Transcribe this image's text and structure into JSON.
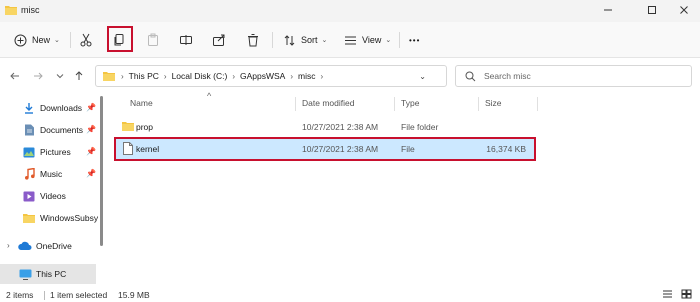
{
  "window": {
    "title": "misc",
    "minimize_icon": "minimize-icon",
    "maximize_icon": "maximize-icon",
    "close_icon": "close-icon"
  },
  "toolbar": {
    "new_label": "New",
    "sort_label": "Sort",
    "view_label": "View",
    "more_label": "•••",
    "icons": [
      "new-icon",
      "cut-icon",
      "copy-icon",
      "paste-icon",
      "rename-icon",
      "share-icon",
      "delete-icon",
      "sort-icon",
      "view-icon"
    ]
  },
  "address": {
    "breadcrumbs": [
      "This PC",
      "Local Disk (C:)",
      "GAppsWSA",
      "misc"
    ],
    "search_placeholder": "Search misc"
  },
  "sidebar": {
    "items": [
      {
        "label": "Downloads",
        "icon": "downloads-icon",
        "pinned": true
      },
      {
        "label": "Documents",
        "icon": "documents-icon",
        "pinned": true
      },
      {
        "label": "Pictures",
        "icon": "pictures-icon",
        "pinned": true
      },
      {
        "label": "Music",
        "icon": "music-icon",
        "pinned": true
      },
      {
        "label": "Videos",
        "icon": "videos-icon",
        "pinned": false
      },
      {
        "label": "WindowsSubsy",
        "icon": "folder-icon",
        "pinned": false
      },
      {
        "label": "OneDrive",
        "icon": "onedrive-icon",
        "pinned": false
      },
      {
        "label": "This PC",
        "icon": "this-pc-icon",
        "pinned": false
      }
    ]
  },
  "columns": [
    "Name",
    "Date modified",
    "Type",
    "Size"
  ],
  "files": [
    {
      "name": "prop",
      "date": "10/27/2021 2:38 AM",
      "type": "File folder",
      "size": "",
      "icon": "folder-icon"
    },
    {
      "name": "kernel",
      "date": "10/27/2021 2:38 AM",
      "type": "File",
      "size": "16,374 KB",
      "icon": "file-icon",
      "selected": true
    }
  ],
  "status": {
    "item_count": "2 items",
    "selection": "1 item selected",
    "selection_size": "15.9 MB"
  },
  "colors": {
    "accent_selection": "#cce8ff",
    "highlight_red": "#c8102e",
    "folder_yellow": "#f4c542"
  }
}
